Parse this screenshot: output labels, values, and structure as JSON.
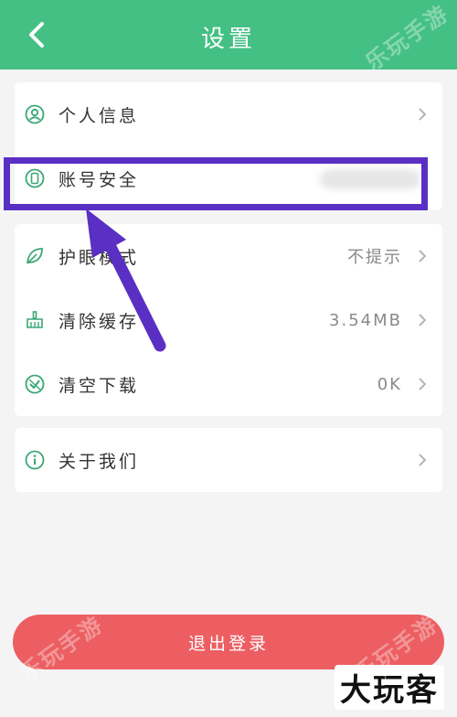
{
  "header": {
    "title": "设置",
    "back_icon": "chevron-left-icon"
  },
  "watermark": {
    "text": "乐玩手游"
  },
  "settings": {
    "group1": [
      {
        "label": "个人信息",
        "icon": "user-circle-icon",
        "value": ""
      },
      {
        "label": "账号安全",
        "icon": "phone-icon",
        "value": ""
      }
    ],
    "group2": [
      {
        "label": "护眼模式",
        "icon": "leaf-icon",
        "value": "不提示"
      },
      {
        "label": "清除缓存",
        "icon": "broom-icon",
        "value": "3.54MB"
      },
      {
        "label": "清空下载",
        "icon": "shield-check-icon",
        "value": "0K"
      }
    ],
    "group3": [
      {
        "label": "关于我们",
        "icon": "info-icon",
        "value": ""
      }
    ]
  },
  "logout": {
    "label": "退出登录"
  },
  "brand": {
    "text": "大玩客"
  },
  "colors": {
    "header": "#44c084",
    "accent_icon": "#3aa776",
    "highlight": "#5a2fc4",
    "logout": "#ec5e62"
  }
}
